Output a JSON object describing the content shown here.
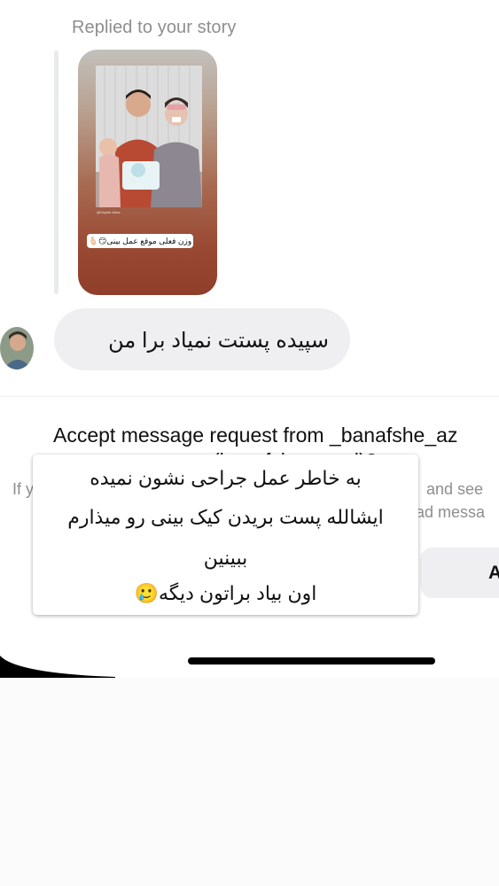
{
  "thread": {
    "replied_label": "Replied to your story",
    "story_caption": "وزن فعلی موقع عمل بینی😏🫰🏻",
    "story_credit": "@Sepide Akira",
    "message_text": "سپیده  پستت  نمیاد برا من"
  },
  "request": {
    "title_line1": "Accept message request from _banafshe_az",
    "title_line2": "(banafshe_azad)?",
    "hint_left": "If y",
    "hint_right_1": "and see",
    "hint_right_2": "ead messa",
    "accept_label": "A"
  },
  "caption_overlay": {
    "line1": "به خاطر عمل جراحی نشون نمیده",
    "line2": "ایشالله پست بریدن کیک بینی رو میذارم",
    "line3": "ببینین",
    "line4": "اون بیاد براتون دیگه🥲"
  },
  "colors": {
    "bubble_bg": "#efeff1",
    "secondary_text": "#8e8e8e",
    "primary_text": "#111111"
  }
}
